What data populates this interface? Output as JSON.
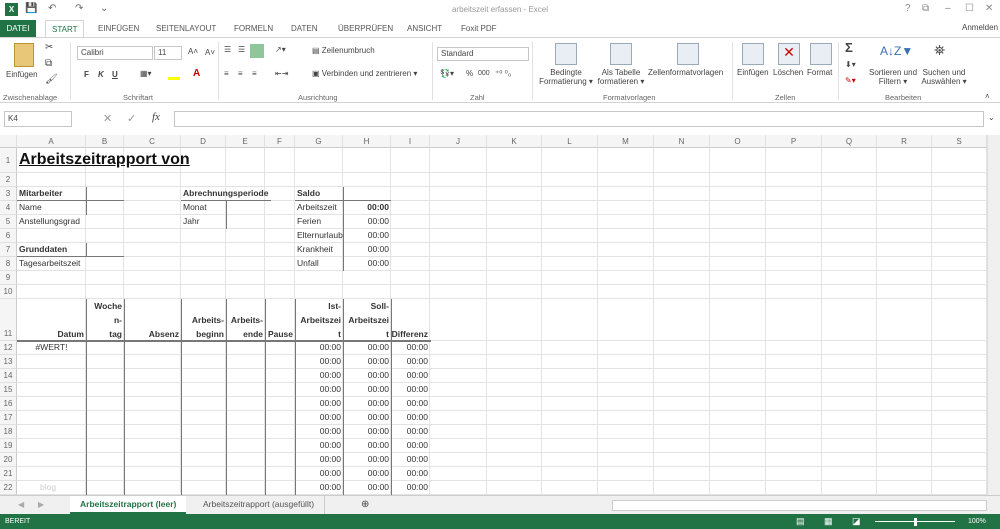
{
  "window": {
    "title": "arbeitszeit erfassen - Excel",
    "app_icon": "X",
    "controls": [
      "?",
      "⧉",
      "–",
      "☐",
      "✕"
    ]
  },
  "quick_access": {
    "save": "💾",
    "undo": "↶",
    "redo": "↷",
    "more": "⌄"
  },
  "tabs": [
    {
      "label": "DATEI"
    },
    {
      "label": "START"
    },
    {
      "label": "EINFÜGEN"
    },
    {
      "label": "SEITENLAYOUT"
    },
    {
      "label": "FORMELN"
    },
    {
      "label": "DATEN"
    },
    {
      "label": "ÜBERPRÜFEN"
    },
    {
      "label": "ANSICHT"
    },
    {
      "label": "Foxit PDF"
    }
  ],
  "account": "Anmelden",
  "ribbon": {
    "paste": "Einfügen",
    "font_name": "Calibri",
    "font_size": "11",
    "bold": "F",
    "italic": "K",
    "underline": "U",
    "wrap": "Zeilenumbruch",
    "merge": "Verbinden und zentrieren",
    "number_format": "Standard",
    "percent": "%",
    "thousands": "000",
    "cond_format": [
      "Bedingte",
      "Formatierung ▾"
    ],
    "as_table": [
      "Als Tabelle",
      "formatieren ▾"
    ],
    "cell_styles": "Zellenformatvorlagen",
    "insert": "Einfügen",
    "delete": "Löschen",
    "format": "Format",
    "sum": "Σ",
    "sort": [
      "Sortieren und",
      "Filtern ▾"
    ],
    "find": [
      "Suchen und",
      "Auswählen ▾"
    ],
    "groups": [
      "Zwischenablage",
      "Schriftart",
      "Ausrichtung",
      "Zahl",
      "Formatvorlagen",
      "Zellen",
      "Bearbeiten"
    ]
  },
  "formula_bar": {
    "name_box": "K4",
    "cancel": "✕",
    "enter": "✓",
    "fx": "fx",
    "value": ""
  },
  "columns": [
    "A",
    "B",
    "C",
    "D",
    "E",
    "F",
    "G",
    "H",
    "I",
    "J",
    "K",
    "L",
    "M",
    "N",
    "O",
    "P",
    "Q",
    "R",
    "S"
  ],
  "rows": [
    "1",
    "2",
    "3",
    "4",
    "5",
    "6",
    "7",
    "8",
    "9",
    "10",
    "11",
    "12",
    "13",
    "14",
    "15",
    "16",
    "17",
    "18",
    "19",
    "20",
    "21",
    "22"
  ],
  "cells": [
    {
      "c": "A",
      "r": 1,
      "v": "Arbeitszeitrapport   von",
      "s": "title"
    },
    {
      "c": "A",
      "r": 3,
      "v": "Mitarbeiter",
      "s": "b"
    },
    {
      "c": "D",
      "r": 3,
      "v": "Abrechnungsperiode",
      "s": "b"
    },
    {
      "c": "G",
      "r": 3,
      "v": "Saldo",
      "s": "b"
    },
    {
      "c": "A",
      "r": 4,
      "v": "Name"
    },
    {
      "c": "D",
      "r": 4,
      "v": "Monat"
    },
    {
      "c": "G",
      "r": 4,
      "v": "Arbeitszeit"
    },
    {
      "c": "H",
      "r": 4,
      "v": "00:00",
      "s": "b r"
    },
    {
      "c": "A",
      "r": 5,
      "v": "Anstellungsgrad"
    },
    {
      "c": "D",
      "r": 5,
      "v": "Jahr"
    },
    {
      "c": "G",
      "r": 5,
      "v": "Ferien"
    },
    {
      "c": "H",
      "r": 5,
      "v": "00:00",
      "s": "r"
    },
    {
      "c": "G",
      "r": 6,
      "v": "Elternurlaub"
    },
    {
      "c": "H",
      "r": 6,
      "v": "00:00",
      "s": "r"
    },
    {
      "c": "A",
      "r": 7,
      "v": "Grunddaten",
      "s": "b"
    },
    {
      "c": "G",
      "r": 7,
      "v": "Krankheit"
    },
    {
      "c": "H",
      "r": 7,
      "v": "00:00",
      "s": "r"
    },
    {
      "c": "A",
      "r": 8,
      "v": "Tagesarbeitszeit"
    },
    {
      "c": "G",
      "r": 8,
      "v": "Unfall"
    },
    {
      "c": "H",
      "r": 8,
      "v": "00:00",
      "s": "r"
    },
    {
      "c": "A",
      "r": 11,
      "v": "Datum",
      "s": "b r"
    },
    {
      "c": "B",
      "r": 11,
      "v": "Woche\nn-\ntag",
      "s": "b r"
    },
    {
      "c": "C",
      "r": 11,
      "v": "Absenz",
      "s": "b r"
    },
    {
      "c": "D",
      "r": 11,
      "v": "Arbeits-\nbeginn",
      "s": "b r"
    },
    {
      "c": "E",
      "r": 11,
      "v": "Arbeits-\nende",
      "s": "b r"
    },
    {
      "c": "F",
      "r": 11,
      "v": "Pause",
      "s": "b r"
    },
    {
      "c": "G",
      "r": 11,
      "v": "Ist-\nArbeitszei\nt",
      "s": "b r"
    },
    {
      "c": "H",
      "r": 11,
      "v": "Soll-\nArbeitszei\nt",
      "s": "b r"
    },
    {
      "c": "I",
      "r": 11,
      "v": "Differenz",
      "s": "b r"
    },
    {
      "c": "A",
      "r": 12,
      "v": "#WERT!",
      "s": "ctr"
    }
  ],
  "time_rows": {
    "from": 12,
    "to": 22,
    "value": "00:00",
    "columns": [
      "G",
      "H",
      "I"
    ]
  },
  "watermark": "blog",
  "sheet_tabs": [
    {
      "label": "Arbeitszeitrapport (leer)",
      "active": true
    },
    {
      "label": "Arbeitszeitrapport (ausgefüllt)",
      "active": false
    }
  ],
  "status": {
    "text": "BEREIT",
    "zoom": "100%",
    "zoom_percent": 100
  },
  "colors": {
    "accent": "#217346"
  }
}
